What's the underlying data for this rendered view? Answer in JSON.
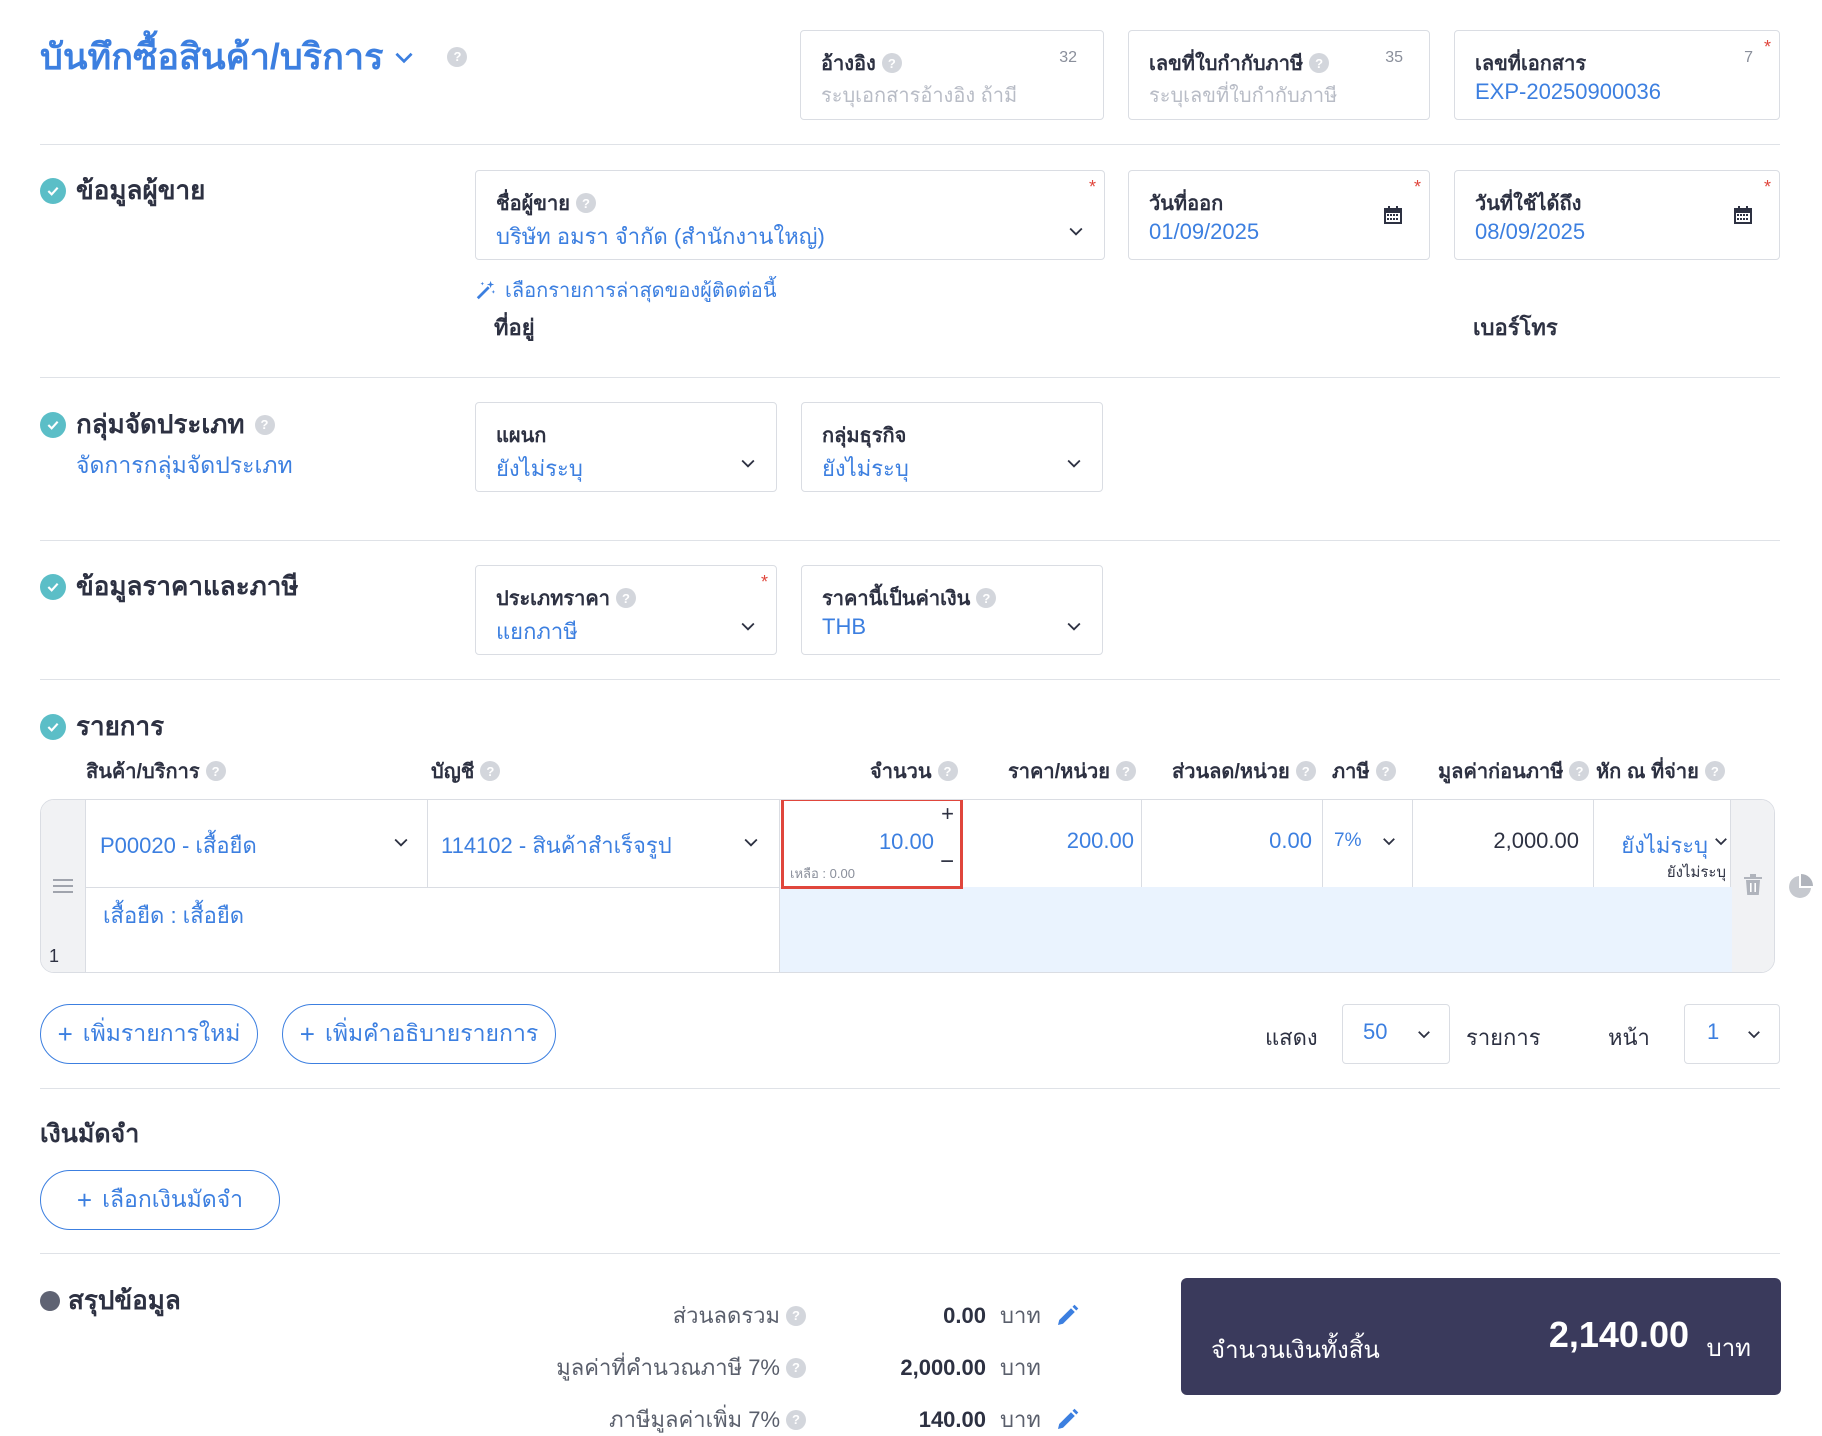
{
  "header": {
    "title": "บันทึกซื้อสินค้า/บริการ",
    "reference": {
      "label": "อ้างอิง",
      "count": "32",
      "placeholder": "ระบุเอกสารอ้างอิง ถ้ามี"
    },
    "tax_invoice_no": {
      "label": "เลขที่ใบกำกับภาษี",
      "count": "35",
      "placeholder": "ระบุเลขที่ใบกำกับภาษี"
    },
    "doc_no": {
      "label": "เลขที่เอกสาร",
      "count": "7",
      "value": "EXP-20250900036"
    }
  },
  "vendor": {
    "section_title": "ข้อมูลผู้ขาย",
    "name_label": "ชื่อผู้ขาย",
    "name_value": "บริษัท อมรา จำกัด (สำนักงานใหญ่)",
    "issue_date_label": "วันที่ออก",
    "issue_date": "01/09/2025",
    "valid_until_label": "วันที่ใช้ได้ถึง",
    "valid_until": "08/09/2025",
    "recent_link": "เลือกรายการล่าสุดของผู้ติดต่อนี้",
    "address_label": "ที่อยู่",
    "phone_label": "เบอร์โทร"
  },
  "classification": {
    "section_title": "กลุ่มจัดประเภท",
    "manage_link": "จัดการกลุ่มจัดประเภท",
    "department_label": "แผนก",
    "department_value": "ยังไม่ระบุ",
    "business_group_label": "กลุ่มธุรกิจ",
    "business_group_value": "ยังไม่ระบุ"
  },
  "pricing": {
    "section_title": "ข้อมูลราคาและภาษี",
    "price_type_label": "ประเภทราคา",
    "price_type_value": "แยกภาษี",
    "currency_label": "ราคานี้เป็นค่าเงิน",
    "currency_value": "THB"
  },
  "items": {
    "section_title": "รายการ",
    "columns": {
      "product": "สินค้า/บริการ",
      "account": "บัญชี",
      "qty": "จำนวน",
      "unit_price": "ราคา/หน่วย",
      "discount": "ส่วนลด/หน่วย",
      "tax": "ภาษี",
      "pretax": "มูลค่าก่อนภาษี",
      "withholding": "หัก ณ ที่จ่าย"
    },
    "rows": [
      {
        "index": "1",
        "product": "P00020 - เสื้อยืด",
        "account": "114102 - สินค้าสำเร็จรูป",
        "qty": "10.00",
        "remaining": "เหลือ : 0.00",
        "unit_price": "200.00",
        "discount": "0.00",
        "tax": "7%",
        "pretax": "2,000.00",
        "withholding": "ยังไม่ระบุ",
        "withholding_sub": "ยังไม่ระบุ",
        "description": "เสื้อยืด : เสื้อยืด"
      }
    ],
    "add_item": "เพิ่มรายการใหม่",
    "add_description": "เพิ่มคำอธิบายรายการ",
    "show_label": "แสดง",
    "page_size": "50",
    "items_label": "รายการ",
    "page_label": "หน้า",
    "page": "1"
  },
  "deposit": {
    "title": "เงินมัดจำ",
    "select_button": "เลือกเงินมัดจำ"
  },
  "summary": {
    "title": "สรุปข้อมูล",
    "total_discount_label": "ส่วนลดรวม",
    "total_discount": "0.00",
    "taxable_label": "มูลค่าที่คำนวณภาษี 7%",
    "taxable": "2,000.00",
    "vat_label": "ภาษีมูลค่าเพิ่ม 7%",
    "vat": "140.00",
    "currency_unit": "บาท",
    "grand_total_label": "จำนวนเงินทั้งสิ้น",
    "grand_total": "2,140.00"
  },
  "colors": {
    "accent": "#3c7fe0",
    "check": "#5bbec7",
    "highlight_border": "#e0463c",
    "total_box": "#3a3a5c"
  }
}
